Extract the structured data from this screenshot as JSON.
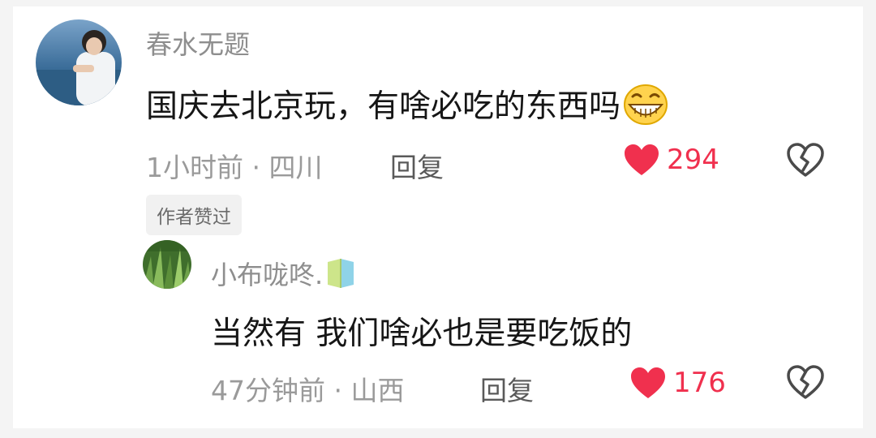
{
  "comments": [
    {
      "username": "春水无题",
      "text": "国庆去北京玩，有啥必吃的东西吗",
      "emoji": "grin-emoji",
      "time": "1小时前 · 四川",
      "reply_label": "回复",
      "likes": "294",
      "badge": "作者赞过"
    },
    {
      "username": "小布咙咚.",
      "text": "当然有 我们啥必也是要吃饭的",
      "time": "47分钟前 · 山西",
      "reply_label": "回复",
      "likes": "176"
    }
  ],
  "colors": {
    "like": "#f0304e",
    "username": "#8e8e8e",
    "meta": "#9a9a9a"
  },
  "icons": [
    "heart-icon",
    "broken-heart-icon",
    "level-badge-icon",
    "grin-emoji"
  ]
}
